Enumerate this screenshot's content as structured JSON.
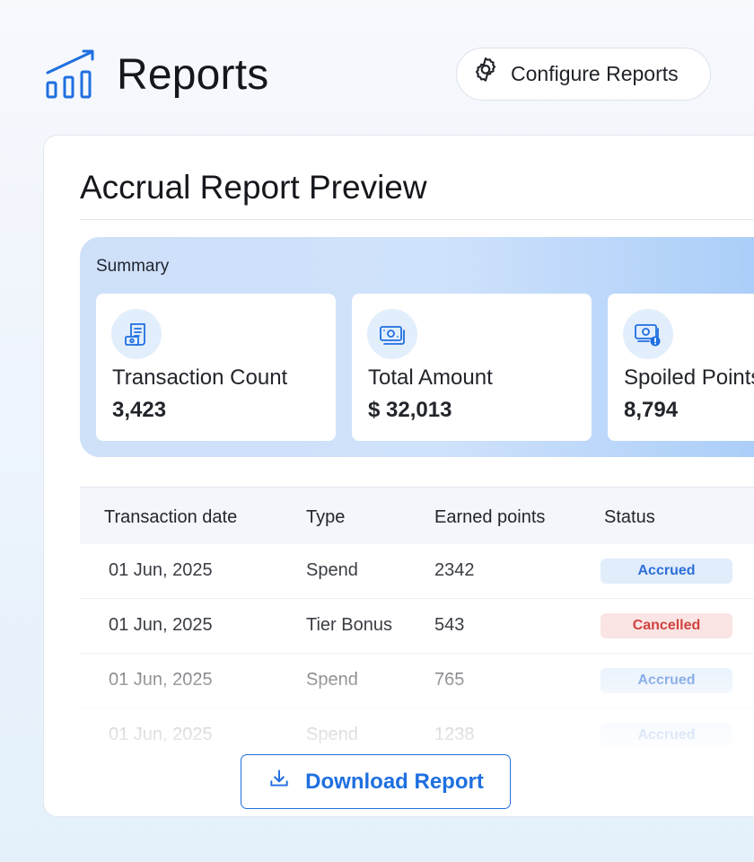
{
  "header": {
    "logo_icon": "bar-chart-trend-icon",
    "title": "Reports",
    "configure_icon": "gear-icon",
    "configure_label": "Configure Reports"
  },
  "card": {
    "title": "Accrual Report Preview",
    "summary": {
      "label": "Summary",
      "stats": [
        {
          "icon": "receipt-cash-icon",
          "label": "Transaction Count",
          "value": "3,423"
        },
        {
          "icon": "banknote-icon",
          "label": "Total Amount",
          "value": "$ 32,013"
        },
        {
          "icon": "banknote-alert-icon",
          "label": "Spoiled Points",
          "value": "8,794"
        }
      ]
    },
    "table": {
      "columns": [
        "Transaction date",
        "Type",
        "Earned points",
        "Status"
      ],
      "rows": [
        {
          "date": "01 Jun, 2025",
          "type": "Spend",
          "points": "2342",
          "status": "Accrued"
        },
        {
          "date": "01 Jun, 2025",
          "type": "Tier Bonus",
          "points": "543",
          "status": "Cancelled"
        },
        {
          "date": "01 Jun, 2025",
          "type": "Spend",
          "points": "765",
          "status": "Accrued"
        },
        {
          "date": "01 Jun, 2025",
          "type": "Spend",
          "points": "1238",
          "status": "Accrued"
        }
      ]
    }
  },
  "download": {
    "icon": "download-icon",
    "label": "Download Report"
  },
  "colors": {
    "accent": "#1f6fe0",
    "accrued_text": "#2f6fd6",
    "accrued_bg": "#e1edfb",
    "cancelled_text": "#d0433f",
    "cancelled_bg": "#fbe4e4"
  }
}
